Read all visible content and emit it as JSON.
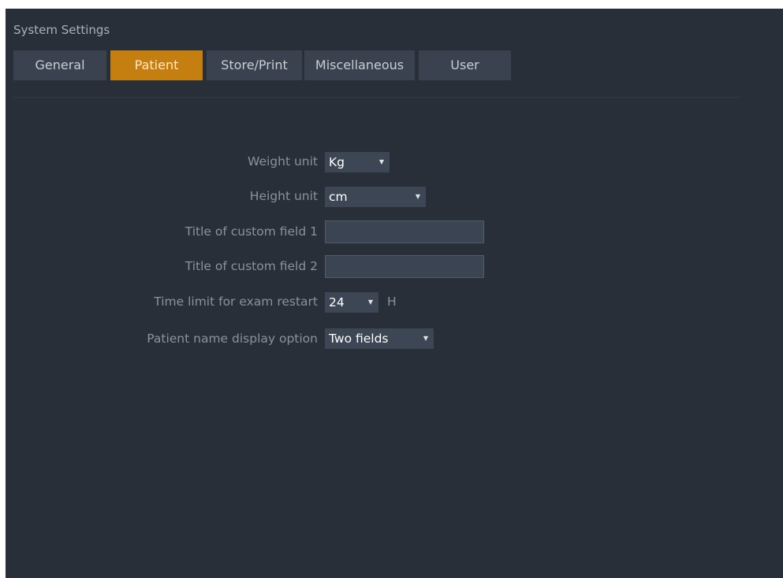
{
  "window": {
    "title": "System Settings"
  },
  "tabs": [
    {
      "label": "General",
      "active": false
    },
    {
      "label": "Patient",
      "active": true
    },
    {
      "label": "Store/Print",
      "active": false
    },
    {
      "label": "Miscellaneous",
      "active": false
    },
    {
      "label": "User",
      "active": false
    }
  ],
  "colors": {
    "background": "#292f39",
    "tab": "#3a4250",
    "tab_active": "#c57f10",
    "field": "#3d4654"
  },
  "form": {
    "weight_unit": {
      "label": "Weight unit",
      "value": "Kg"
    },
    "height_unit": {
      "label": "Height unit",
      "value": "cm"
    },
    "custom_field_1": {
      "label": "Title of custom field 1",
      "value": "",
      "placeholder": ""
    },
    "custom_field_2": {
      "label": "Title of custom field 2",
      "value": "",
      "placeholder": ""
    },
    "exam_restart": {
      "label": "Time limit for exam restart",
      "value": "24",
      "unit": "H"
    },
    "name_display": {
      "label": "Patient name display option",
      "value": "Two fields"
    }
  },
  "icons": {
    "dropdown": "chevron-down-icon"
  }
}
